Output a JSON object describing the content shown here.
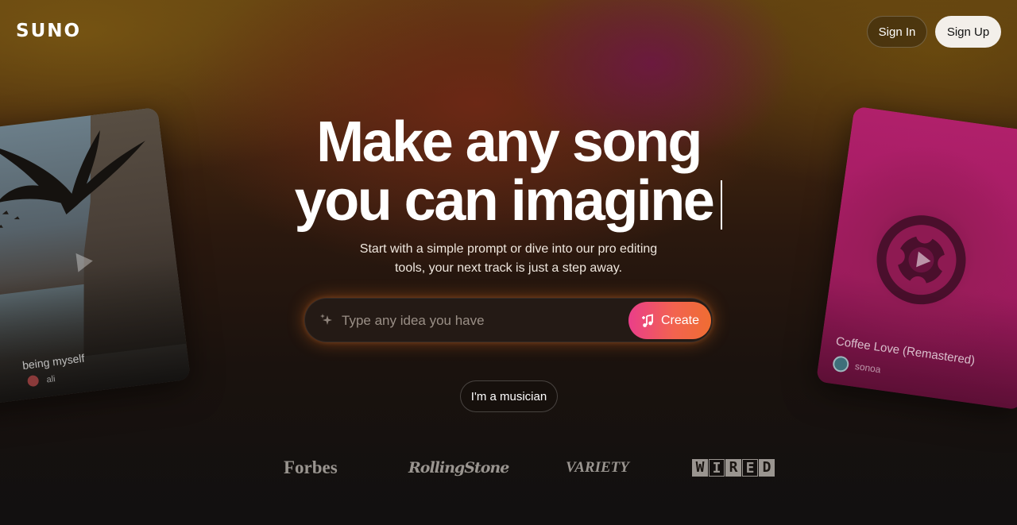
{
  "header": {
    "logo": "SUNO",
    "sign_in_label": "Sign In",
    "sign_up_label": "Sign Up"
  },
  "hero": {
    "headline_line1": "Make any song",
    "headline_line2": "you can imagine",
    "subheadline_line1": "Start with a simple prompt or dive into our pro editing",
    "subheadline_line2": "tools, your next track is just a step away."
  },
  "prompt": {
    "placeholder": "Type any idea you have",
    "value": "",
    "create_label": "Create",
    "sparkle_icon": "sparkle-icon",
    "create_icon": "music-note-plus-icon"
  },
  "musician_label": "I'm a musician",
  "cards": {
    "left": {
      "title": "being myself",
      "user": "ali"
    },
    "right": {
      "title": "Coffee Love (Remastered)",
      "user": "sonoa"
    }
  },
  "press": [
    "Forbes",
    "RollingStone",
    "VARIETY",
    "WIRED"
  ],
  "colors": {
    "accent_gradient_start": "#ea3e8a",
    "accent_gradient_end": "#ef6d32",
    "sign_up_bg": "#f3efea",
    "input_bg": "#241a15",
    "press_logo": "#9a9590"
  }
}
